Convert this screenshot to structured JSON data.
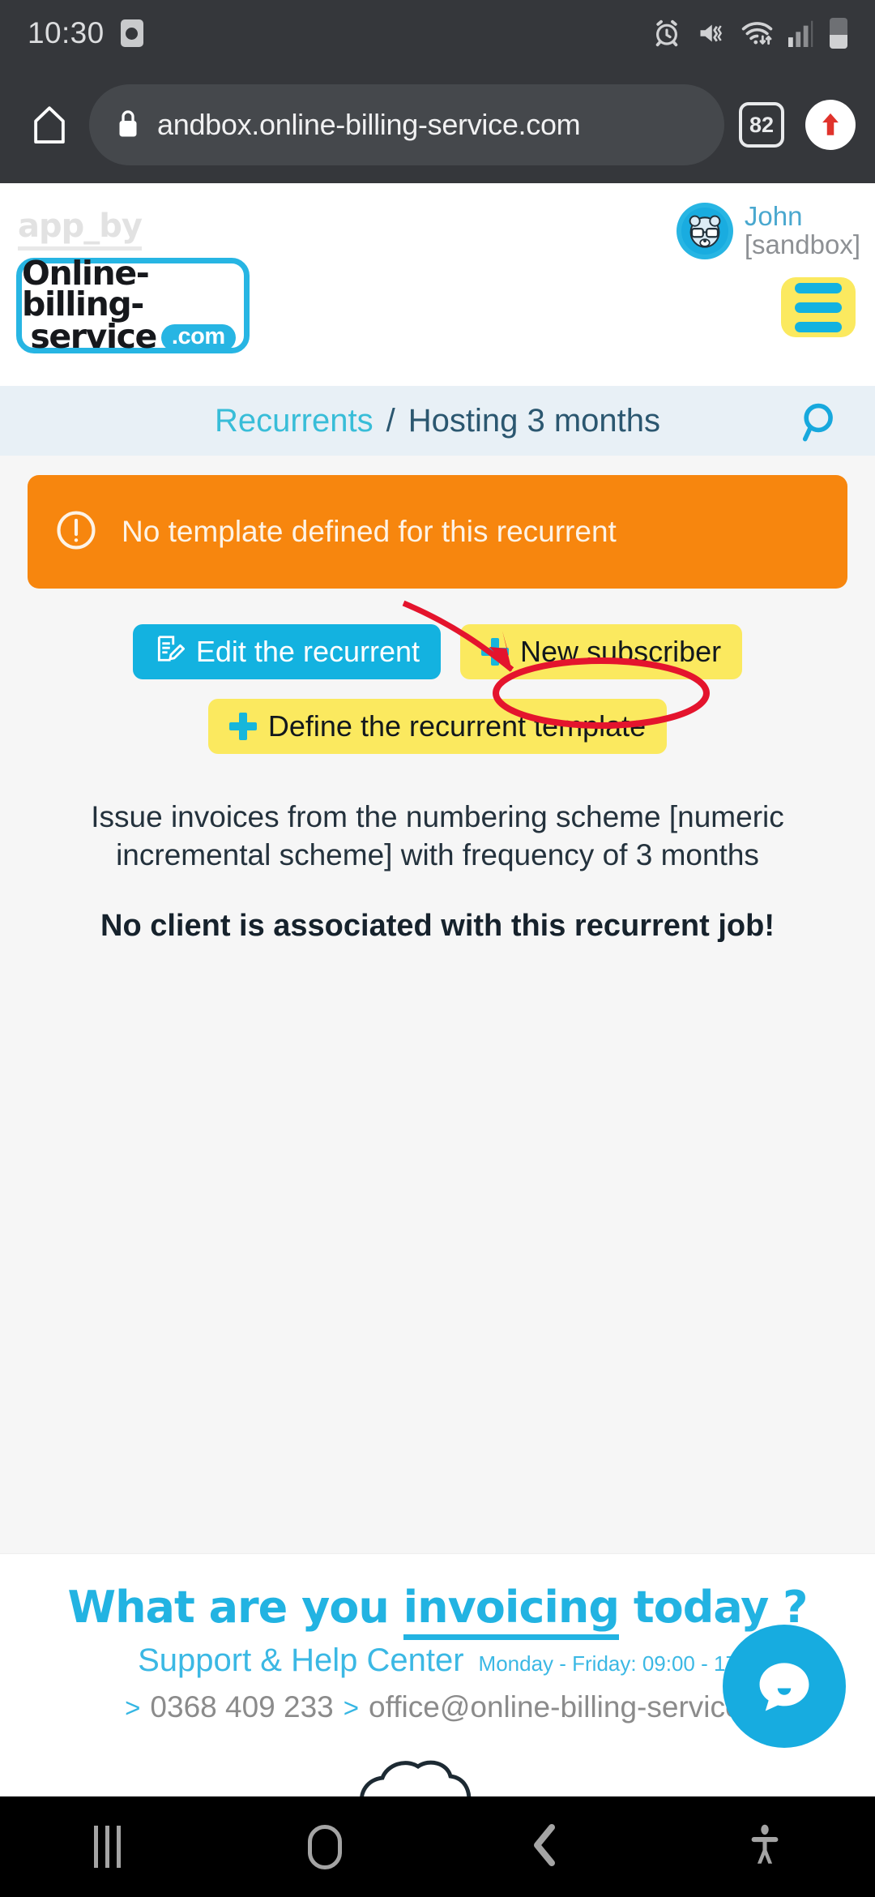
{
  "status_bar": {
    "time": "10:30",
    "icons": [
      "screen-capture-icon",
      "alarm-icon",
      "mute-vibrate-icon",
      "wifi-icon",
      "signal-icon",
      "battery-icon"
    ]
  },
  "browser": {
    "home_label": "home-icon",
    "lock_label": "lock-icon",
    "url": "andbox.online-billing-service.com",
    "tab_count": "82",
    "menu_label": "page-actions-icon"
  },
  "site_header": {
    "app_by": "app_by",
    "logo_line1": "Online-billing-",
    "logo_line2": "service",
    "logo_badge": ".com",
    "user_name": "John",
    "user_mode": "[sandbox]",
    "menu_label": "hamburger-menu"
  },
  "breadcrumb": {
    "parent": "Recurrents",
    "separator": "/",
    "current": "Hosting 3 months",
    "search_label": "search-icon"
  },
  "alert": {
    "icon": "exclamation-circle-icon",
    "message": "No template defined for this recurrent"
  },
  "actions": {
    "edit_recurrent": "Edit the recurrent",
    "new_subscriber": "New subscriber",
    "define_template": "Define the recurrent template"
  },
  "content": {
    "description": "Issue invoices from the numbering scheme [numeric incremental scheme] with frequency of 3 months",
    "no_client_note": "No client is associated with this recurrent job!"
  },
  "footer": {
    "slogan_pre": "What are you ",
    "slogan_underlined": "invoicing",
    "slogan_post": " today ?",
    "help_title": "Support & Help Center",
    "help_hours": "Monday - Friday: 09:00 - 17",
    "arrow": ">",
    "phone": "0368 409 233",
    "email": "office@online-billing-service.",
    "chat_label": "chat-bubble-icon"
  },
  "annotations": {
    "arrow": "red-arrow-pointer",
    "ellipse": "red-ellipse-highlight",
    "target": "New subscriber"
  },
  "nav_bar": {
    "recent": "recent-apps-icon",
    "home": "home-icon",
    "back": "back-icon",
    "accessibility": "accessibility-icon"
  },
  "colors": {
    "accent_cyan": "#13b2e0",
    "accent_yellow": "#fbe95f",
    "alert_orange": "#f7860e",
    "annotation_red": "#e4142d",
    "breadcrumb_bg": "#e8f0f6"
  }
}
